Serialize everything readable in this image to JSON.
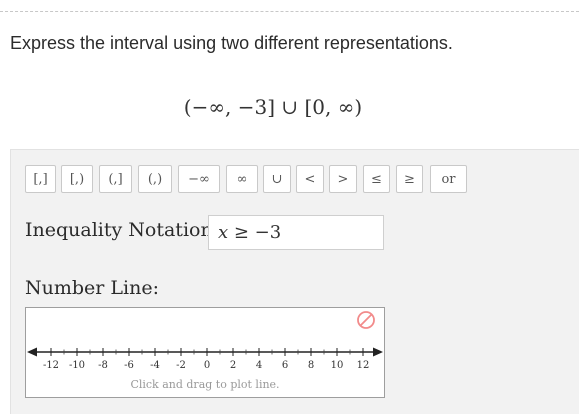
{
  "question": {
    "prompt": "Express the interval using two different representations.",
    "expression": "(−∞, −3] ∪ [0, ∞)"
  },
  "toolbar": {
    "buttons": [
      "[,]",
      "[,)",
      "(,]",
      "(,)",
      "−∞",
      "∞",
      "∪",
      "<",
      ">",
      "≤",
      "≥",
      "or"
    ]
  },
  "inequality": {
    "label": "Inequality Notation:",
    "value_var": "x",
    "value_rest": " ≥ −3"
  },
  "number_line": {
    "label": "Number Line:",
    "tick_labels": [
      "-12",
      "-10",
      "-8",
      "-6",
      "-4",
      "-2",
      "0",
      "2",
      "4",
      "6",
      "8",
      "10",
      "12"
    ],
    "hint": "Click and drag to plot line.",
    "clear_icon": "no-entry-icon",
    "axis_color": "#222222",
    "clear_icon_color": "#f28b8b"
  }
}
